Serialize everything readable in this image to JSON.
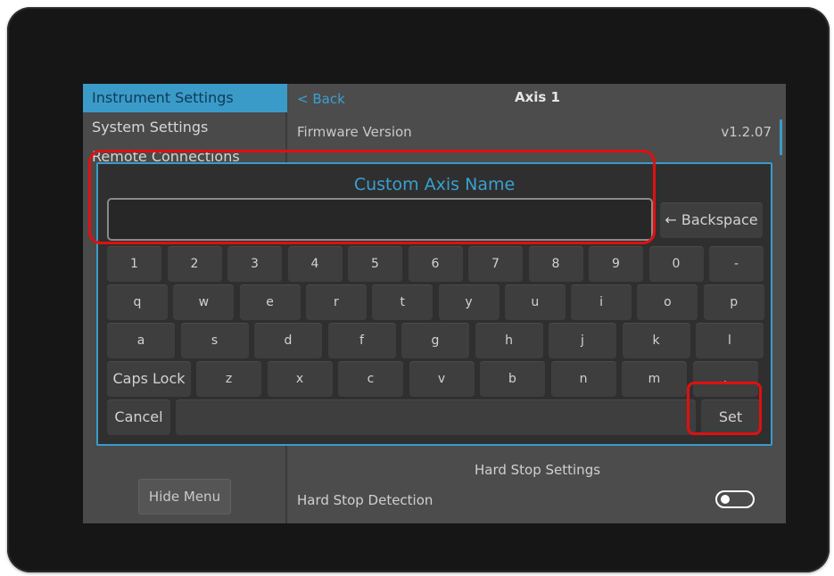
{
  "menu": {
    "items": [
      {
        "label": "Instrument Settings",
        "selected": true
      },
      {
        "label": "System Settings",
        "selected": false
      },
      {
        "label": "Remote Connections",
        "selected": false
      }
    ],
    "hide_menu_label": "Hide Menu"
  },
  "pane": {
    "back_label": "< Back",
    "title": "Axis 1",
    "firmware_label": "Firmware Version",
    "firmware_value": "v1.2.07",
    "hard_stop_title": "Hard Stop Settings",
    "hard_stop_label": "Hard Stop Detection",
    "hard_stop_enabled": false
  },
  "dialog": {
    "title": "Custom Axis Name",
    "input_value": "",
    "backspace_label": "← Backspace",
    "rows": [
      [
        "1",
        "2",
        "3",
        "4",
        "5",
        "6",
        "7",
        "8",
        "9",
        "0",
        "-"
      ],
      [
        "q",
        "w",
        "e",
        "r",
        "t",
        "y",
        "u",
        "i",
        "o",
        "p"
      ],
      [
        "a",
        "s",
        "d",
        "f",
        "g",
        "h",
        "j",
        "k",
        "l"
      ],
      [
        "z",
        "x",
        "c",
        "v",
        "b",
        "n",
        "m",
        "."
      ]
    ],
    "caps_lock_label": "Caps Lock",
    "cancel_label": "Cancel",
    "set_label": "Set"
  },
  "colors": {
    "accent": "#3a9bc9",
    "highlight": "#e01010",
    "background": "#4b4b4b",
    "dialog": "#2f2f2f"
  }
}
